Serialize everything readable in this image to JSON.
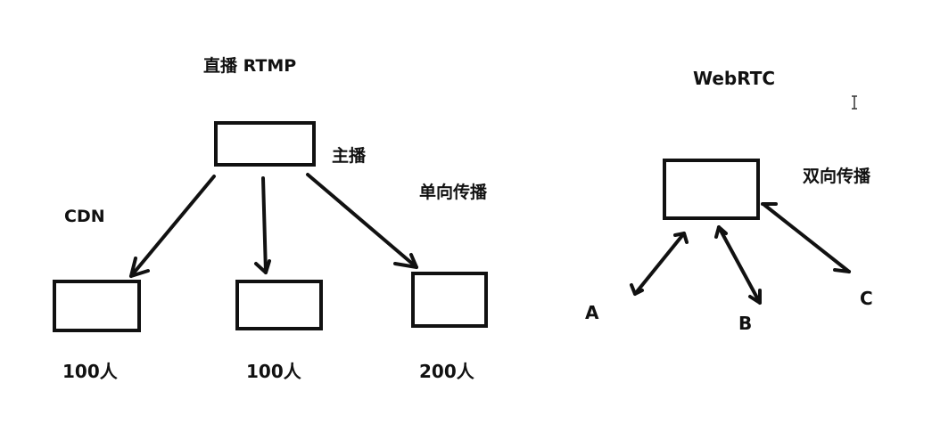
{
  "rtmp": {
    "title": "直播 RTMP",
    "anchor_label": "主播",
    "mode_label": "单向传播",
    "cdn_label": "CDN",
    "audiences": [
      "100人",
      "100人",
      "200人"
    ]
  },
  "webrtc": {
    "title": "WebRTC",
    "mode_label": "双向传播",
    "peers": [
      "A",
      "B",
      "C"
    ]
  },
  "colors": {
    "ink": "#111111",
    "background": "#ffffff"
  }
}
